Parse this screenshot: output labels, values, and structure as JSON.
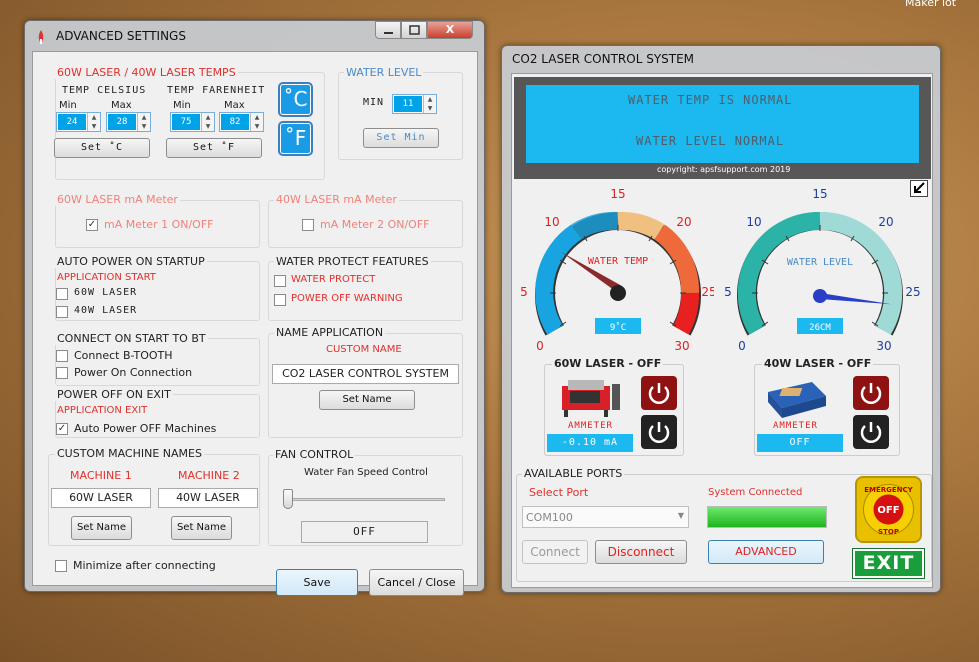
{
  "desktop_corner_text": "Maker lot",
  "adv": {
    "title": "ADVANCED SETTINGS",
    "temps_group": "60W LASER / 40W LASER TEMPS",
    "celsius_label": "TEMP CELSIUS",
    "fahrenheit_label": "TEMP FARENHEIT",
    "min_label": "Min",
    "max_label": "Max",
    "c_min": "24",
    "c_max": "28",
    "f_min": "75",
    "f_max": "82",
    "set_c": "Set ˚C",
    "set_f": "Set ˚F",
    "c_icon": "˚C",
    "f_icon": "˚F",
    "water_level_group": "WATER LEVEL",
    "wl_min_label": "MIN",
    "wl_min": "11",
    "set_min": "Set Min",
    "ma1_group": "60W LASER mA Meter",
    "ma1_label": "mA Meter 1 ON/OFF",
    "ma1_checked": true,
    "ma2_group": "40W LASER mA Meter",
    "ma2_label": "mA Meter 2 ON/OFF",
    "ma2_checked": false,
    "auto_power_group": "AUTO POWER ON STARTUP",
    "app_start": "APPLICATION  START",
    "auto_60w": "60W  LASER",
    "auto_40w": "40W  LASER",
    "water_protect_group": "WATER PROTECT FEATURES",
    "water_protect": "WATER PROTECT",
    "power_off_warning": "POWER OFF WARNING",
    "connect_bt_group": "CONNECT ON START TO BT",
    "connect_btooth": "Connect B-TOOTH",
    "power_on_conn": "Power On Connection",
    "name_app_group": "NAME APPLICATION",
    "custom_name_label": "CUSTOM NAME",
    "app_name": "CO2 LASER CONTROL SYSTEM",
    "set_name": "Set Name",
    "power_off_exit_group": "POWER OFF ON EXIT",
    "app_exit": "APPLICATION EXIT",
    "auto_power_off": "Auto Power OFF Machines",
    "auto_power_off_checked": true,
    "custom_machine_group": "CUSTOM MACHINE NAMES",
    "machine1_label": "MACHINE 1",
    "machine2_label": "MACHINE 2",
    "machine1_name": "60W LASER",
    "machine2_name": "40W LASER",
    "fan_group": "FAN CONTROL",
    "fan_label": "Water Fan Speed Control",
    "fan_value": "OFF",
    "minimize_label": "Minimize after connecting",
    "save": "Save",
    "cancel": "Cancel / Close"
  },
  "co2": {
    "title": "CO2 LASER CONTROL SYSTEM",
    "status_line1": "WATER TEMP IS NORMAL",
    "status_line2": "WATER LEVEL NORMAL",
    "copyright": "copyright: apsfsupport.com 2019",
    "temp_gauge": {
      "label": "WATER TEMP",
      "ticks": [
        "0",
        "5",
        "10",
        "15",
        "20",
        "25",
        "30"
      ],
      "readout": "9˚C",
      "value": 9
    },
    "level_gauge": {
      "label": "WATER LEVEL",
      "ticks": [
        "0",
        "5",
        "10",
        "15",
        "20",
        "25",
        "30"
      ],
      "readout": "26CM",
      "value": 26
    },
    "laser60_title": "60W LASER - OFF",
    "laser40_title": "40W LASER - OFF",
    "ammeter_label": "AMMETER",
    "ammeter60": "-0.10 mA",
    "ammeter40": "OFF",
    "ports_group": "AVAILABLE PORTS",
    "select_port": "Select Port",
    "port_value": "COM100",
    "connect": "Connect",
    "disconnect": "Disconnect",
    "system_connected": "System Connected",
    "connection_progress": 1.0,
    "advanced": "ADVANCED",
    "estop_top": "EMERGENCY",
    "estop_mid": "OFF",
    "estop_bot": "STOP",
    "exit": "EXIT"
  },
  "colors": {
    "accent": "#00a2e8",
    "lcd": "#1cb8f0",
    "red_text": "#e0302c",
    "green_exit": "#1a9e3c"
  }
}
